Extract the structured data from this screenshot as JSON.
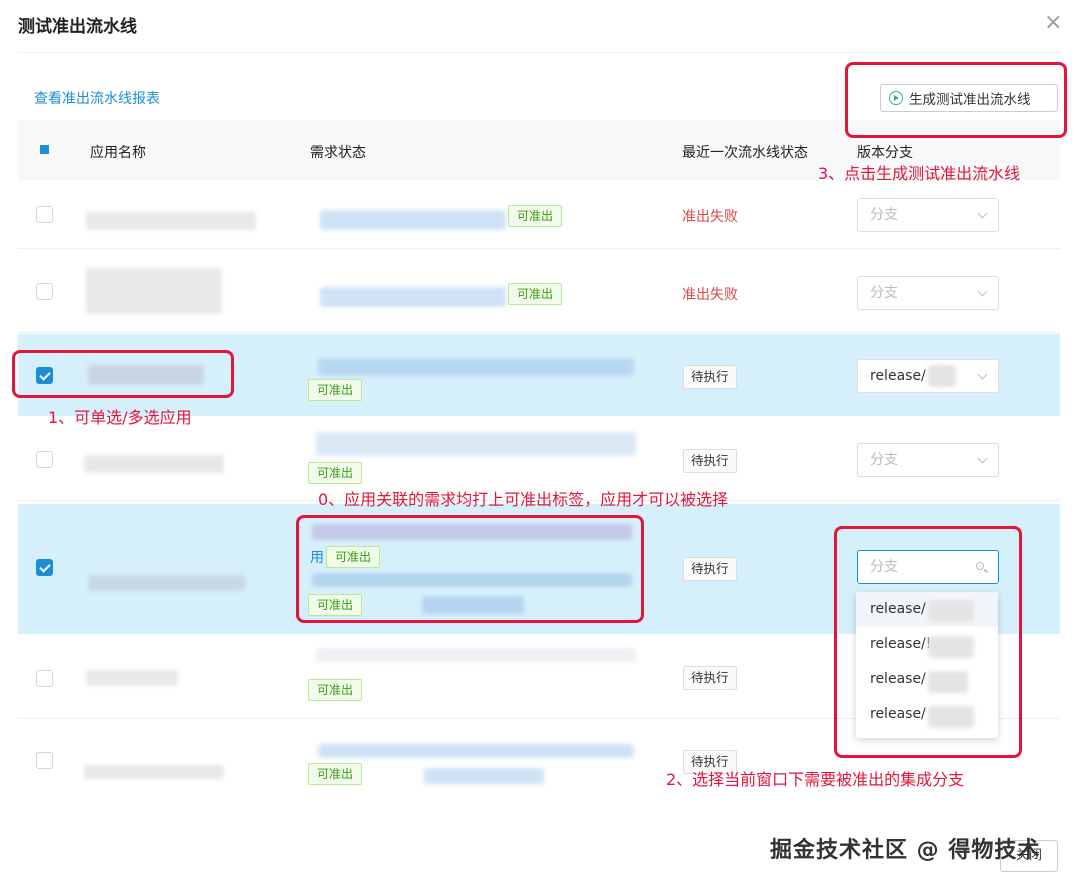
{
  "dialog": {
    "title": "测试准出流水线",
    "close_icon": "×"
  },
  "toolbar": {
    "report_link": "查看准出流水线报表",
    "generate_button": "生成测试准出流水线"
  },
  "table": {
    "columns": [
      "应用名称",
      "需求状态",
      "最近一次流水线状态",
      "版本分支"
    ],
    "rows": [
      {
        "checked": false,
        "status_tag": "可准出",
        "pipeline_status": "准出失败",
        "branch": "分支"
      },
      {
        "checked": false,
        "status_tag": "可准出",
        "pipeline_status": "准出失败",
        "branch": "分支"
      },
      {
        "checked": true,
        "status_tag": "可准出",
        "pipeline_status": "待执行",
        "branch": "release/"
      },
      {
        "checked": false,
        "status_tag": "可准出",
        "pipeline_status": "待执行",
        "branch": "分支"
      },
      {
        "checked": true,
        "status_prefix": "用",
        "status_tag": "可准出",
        "status_tag_2": "可准出",
        "pipeline_status": "待执行",
        "branch": "分支"
      },
      {
        "checked": false,
        "status_tag": "可准出",
        "pipeline_status": "待执行",
        "branch": ""
      },
      {
        "checked": false,
        "status_tag": "可准出",
        "pipeline_status": "待执行",
        "branch": ""
      }
    ]
  },
  "dropdown": {
    "options": [
      "release/",
      "release/!",
      "release/",
      "release/"
    ]
  },
  "annotations": {
    "note_0": "0、应用关联的需求均打上可准出标签，应用才可以被选择",
    "note_1": "1、可单选/多选应用",
    "note_2": "2、选择当前窗口下需要被准出的集成分支",
    "note_3": "3、点击生成测试准出流水线"
  },
  "footer": {
    "watermark": "掘金技术社区 @ 得物技术",
    "close_button": "关闭"
  },
  "colors": {
    "accent": "#1a8fd6",
    "annotation_red": "#e3163a",
    "fail_red": "#e04646",
    "selected_row": "#d6f0fb"
  }
}
